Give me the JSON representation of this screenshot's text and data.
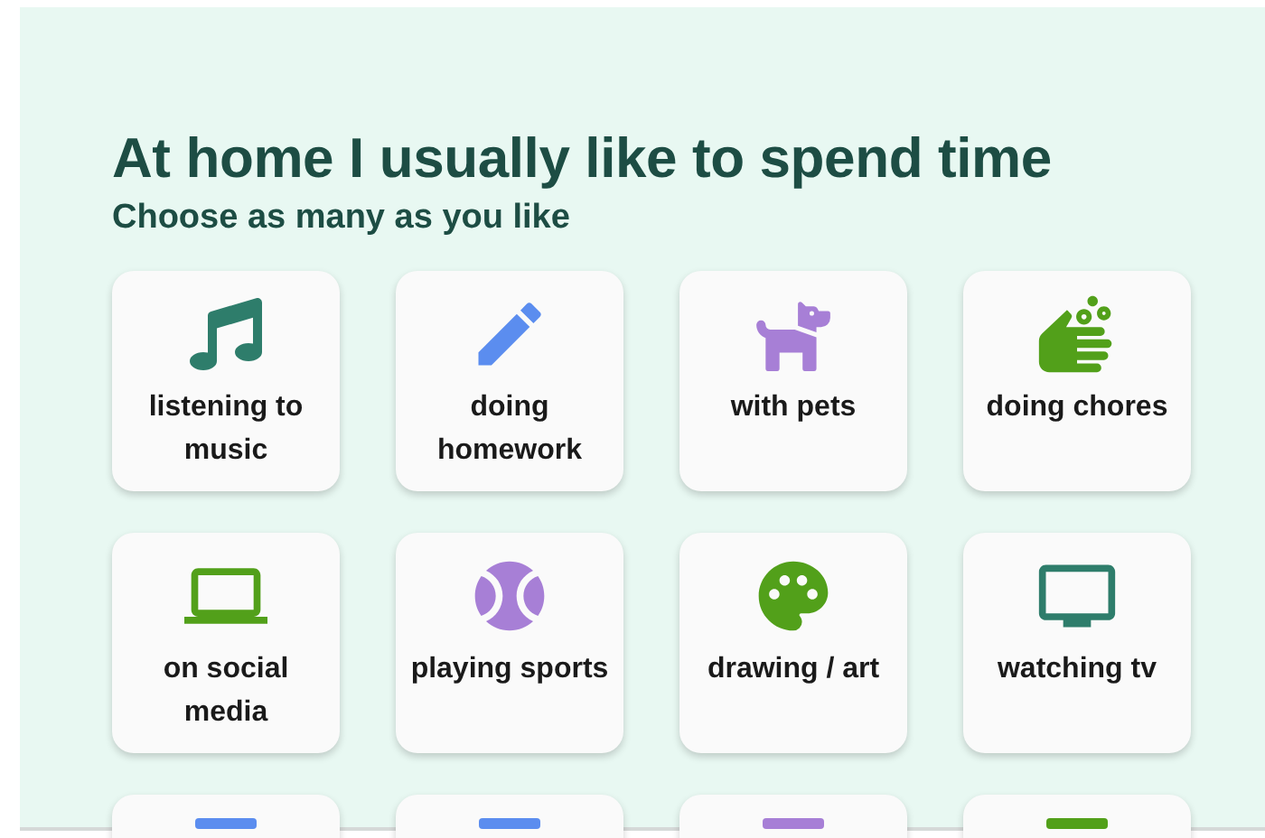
{
  "title": "At home I usually like to spend time",
  "subtitle": "Choose as many as you like",
  "options": [
    {
      "kind": "music",
      "label": "listening to music",
      "color": "#2e7d6b"
    },
    {
      "kind": "pen",
      "label": "doing homework",
      "color": "#5b8def"
    },
    {
      "kind": "dog",
      "label": "with pets",
      "color": "#a77fd6"
    },
    {
      "kind": "soap",
      "label": "doing chores",
      "color": "#52a01a"
    },
    {
      "kind": "laptop",
      "label": "on social media",
      "color": "#52a01a"
    },
    {
      "kind": "ball",
      "label": "playing sports",
      "color": "#a77fd6"
    },
    {
      "kind": "palette",
      "label": "drawing / art",
      "color": "#52a01a"
    },
    {
      "kind": "tv",
      "label": "watching tv",
      "color": "#2e7d6b"
    },
    {
      "kind": "cut",
      "color": "#5b8def"
    },
    {
      "kind": "cut",
      "color": "#5b8def"
    },
    {
      "kind": "cut",
      "color": "#a77fd6"
    },
    {
      "kind": "cut",
      "color": "#52a01a"
    }
  ]
}
